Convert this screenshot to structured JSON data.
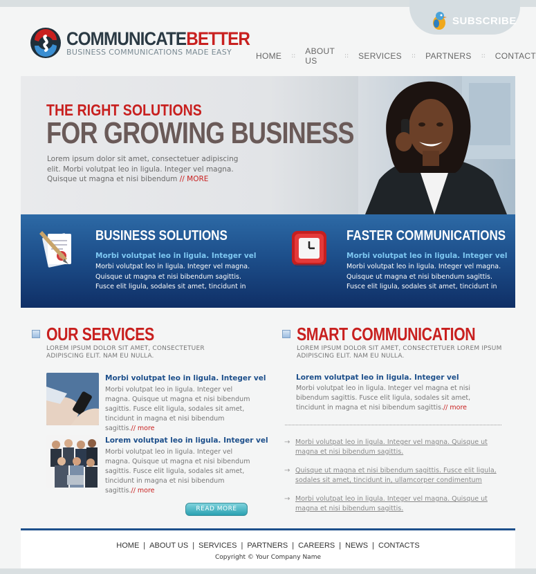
{
  "brand": {
    "name_part1": "COMMUNICATE",
    "name_part2": "BETTER",
    "tagline": "BUSINESS COMMUNICATIONS MADE EASY"
  },
  "subscribe": {
    "label": "SUBSCRIBE",
    "icon": "bird-icon"
  },
  "nav": {
    "items": [
      "HOME",
      "ABOUT US",
      "SERVICES",
      "PARTNERS",
      "CONTACT"
    ],
    "separator": "::"
  },
  "hero": {
    "line1": "THE RIGHT SOLUTIONS",
    "line2": "FOR GROWING BUSINESS",
    "text": "Lorem ipsum dolor sit amet, consectetuer adipiscing elit. Morbi volutpat leo in ligula. Integer vel magna. Quisque ut magna et nisi bibendum ",
    "more": "// MORE"
  },
  "band": {
    "col1": {
      "icon": "document-pen-icon",
      "title": "BUSINESS SOLUTIONS",
      "subtitle": "Morbi volutpat leo in ligula. Integer vel",
      "text": "Morbi volutpat leo in ligula. Integer vel magna. Quisque ut magna et nisi bibendum sagittis. Fusce elit ligula, sodales sit amet, tincidunt in"
    },
    "col2": {
      "icon": "clock-icon",
      "title": "FASTER COMMUNICATIONS",
      "subtitle": "Morbi volutpat leo in ligula. Integer vel",
      "text": "Morbi volutpat leo in ligula. Integer vel magna. Quisque ut magna et nisi bibendum sagittis. Fusce elit ligula, sodales sit amet, tincidunt in"
    }
  },
  "services": {
    "title": "OUR SERVICES",
    "subtitle_line1": "LOREM IPSUM DOLOR SIT AMET, CONSECTETUER",
    "subtitle_line2": "ADIPISCING ELIT. NAM EU NULLA.",
    "items": [
      {
        "title": "Morbi volutpat leo in ligula. Integer vel",
        "text": "Morbi volutpat leo in ligula. Integer vel magna. Quisque ut magna et nisi bibendum sagittis. Fusce elit ligula, sodales sit amet, tincidunt in magna et nisi bibendum sagittis.",
        "more": "// more"
      },
      {
        "title": "Lorem volutpat leo in ligula. Integer vel",
        "text": "Morbi volutpat leo in ligula. Integer vel magna. Quisque ut magna et nisi bibendum sagittis. Fusce elit ligula, sodales sit amet, tincidunt in magna et nisi bibendum sagittis.",
        "more": "// more"
      }
    ],
    "read_more": "READ MORE"
  },
  "smart": {
    "title": "SMART COMMUNICATION",
    "subtitle_line1": "LOREM IPSUM DOLOR SIT AMET, CONSECTETUER LOREM IPSUM",
    "subtitle_line2": "ADIPISCING ELIT. NAM EU NULLA.",
    "feature_title": "Lorem volutpat leo in ligula. Integer vel",
    "feature_text": "Morbi volutpat leo in ligula. Integer vel magna et nisi bibendum sagittis. Fusce elit ligula, sodales sit amet, tincidunt in magna et nisi bibendum sagittis.",
    "feature_more": "// more",
    "links": [
      "Morbi volutpat leo in ligula. Integer vel magna. Quisque ut magna et nisi bibendum sagittis.",
      "Quisque ut magna et nisi bibendum sagittis. Fusce elit ligula, sodales sit amet, tincidunt in, ullamcorper condimentum",
      "Morbi volutpat leo in ligula. Integer vel magna. Quisque ut magna et nisi bibendum sagittis."
    ]
  },
  "footer": {
    "links": [
      "HOME",
      "ABOUT US",
      "SERVICES",
      "PARTNERS",
      "CAREERS",
      "NEWS",
      "CONTACTS"
    ],
    "copyright": "Copyright © Your Company Name"
  },
  "colors": {
    "accent": "#c8201f",
    "brand_blue": "#1d4f8b",
    "band_sub": "#7ec8f2"
  }
}
